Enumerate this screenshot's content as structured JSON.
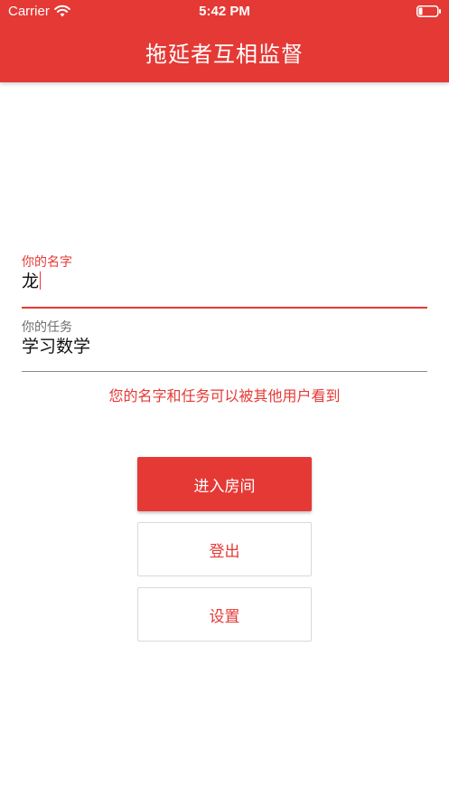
{
  "status_bar": {
    "carrier": "Carrier",
    "time": "5:42 PM",
    "wifi_icon": "wifi-icon",
    "battery_icon": "battery-icon"
  },
  "app_bar": {
    "title": "拖延者互相监督"
  },
  "form": {
    "name_field": {
      "label": "你的名字",
      "value": "龙"
    },
    "task_field": {
      "label": "你的任务",
      "value": "学习数学"
    },
    "hint": "您的名字和任务可以被其他用户看到"
  },
  "buttons": {
    "enter_room": "进入房间",
    "logout": "登出",
    "settings": "设置"
  },
  "colors": {
    "accent": "#e53935",
    "background": "#ffffff",
    "text": "#111111",
    "secondary_label": "#6e6e6e"
  }
}
